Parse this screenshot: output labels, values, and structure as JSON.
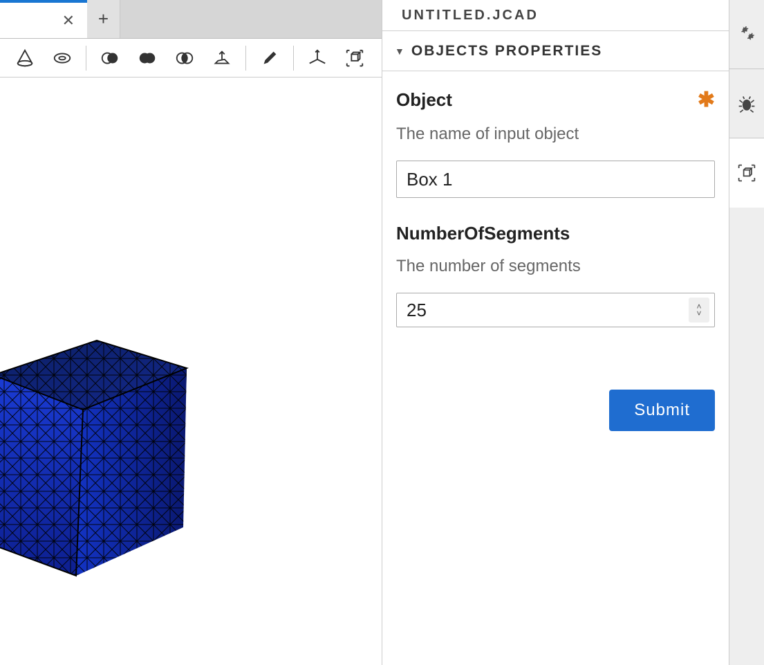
{
  "file": {
    "title": "UNTITLED.JCAD"
  },
  "section": {
    "title": "OBJECTS PROPERTIES"
  },
  "form": {
    "object": {
      "label": "Object",
      "desc": "The name of input object",
      "value": "Box 1",
      "required": true
    },
    "segments": {
      "label": "NumberOfSegments",
      "desc": "The number of segments",
      "value": "25"
    },
    "submit": "Submit"
  },
  "toolbar": {
    "icons": [
      "cone-icon",
      "torus-icon",
      "boolean-a-icon",
      "boolean-b-icon",
      "boolean-c-icon",
      "extrude-icon",
      "pencil-icon",
      "axis-icon",
      "cube-frame-icon"
    ]
  },
  "rightbar": {
    "icons": [
      "settings-icon",
      "bug-icon",
      "viewport-cube-icon"
    ]
  }
}
